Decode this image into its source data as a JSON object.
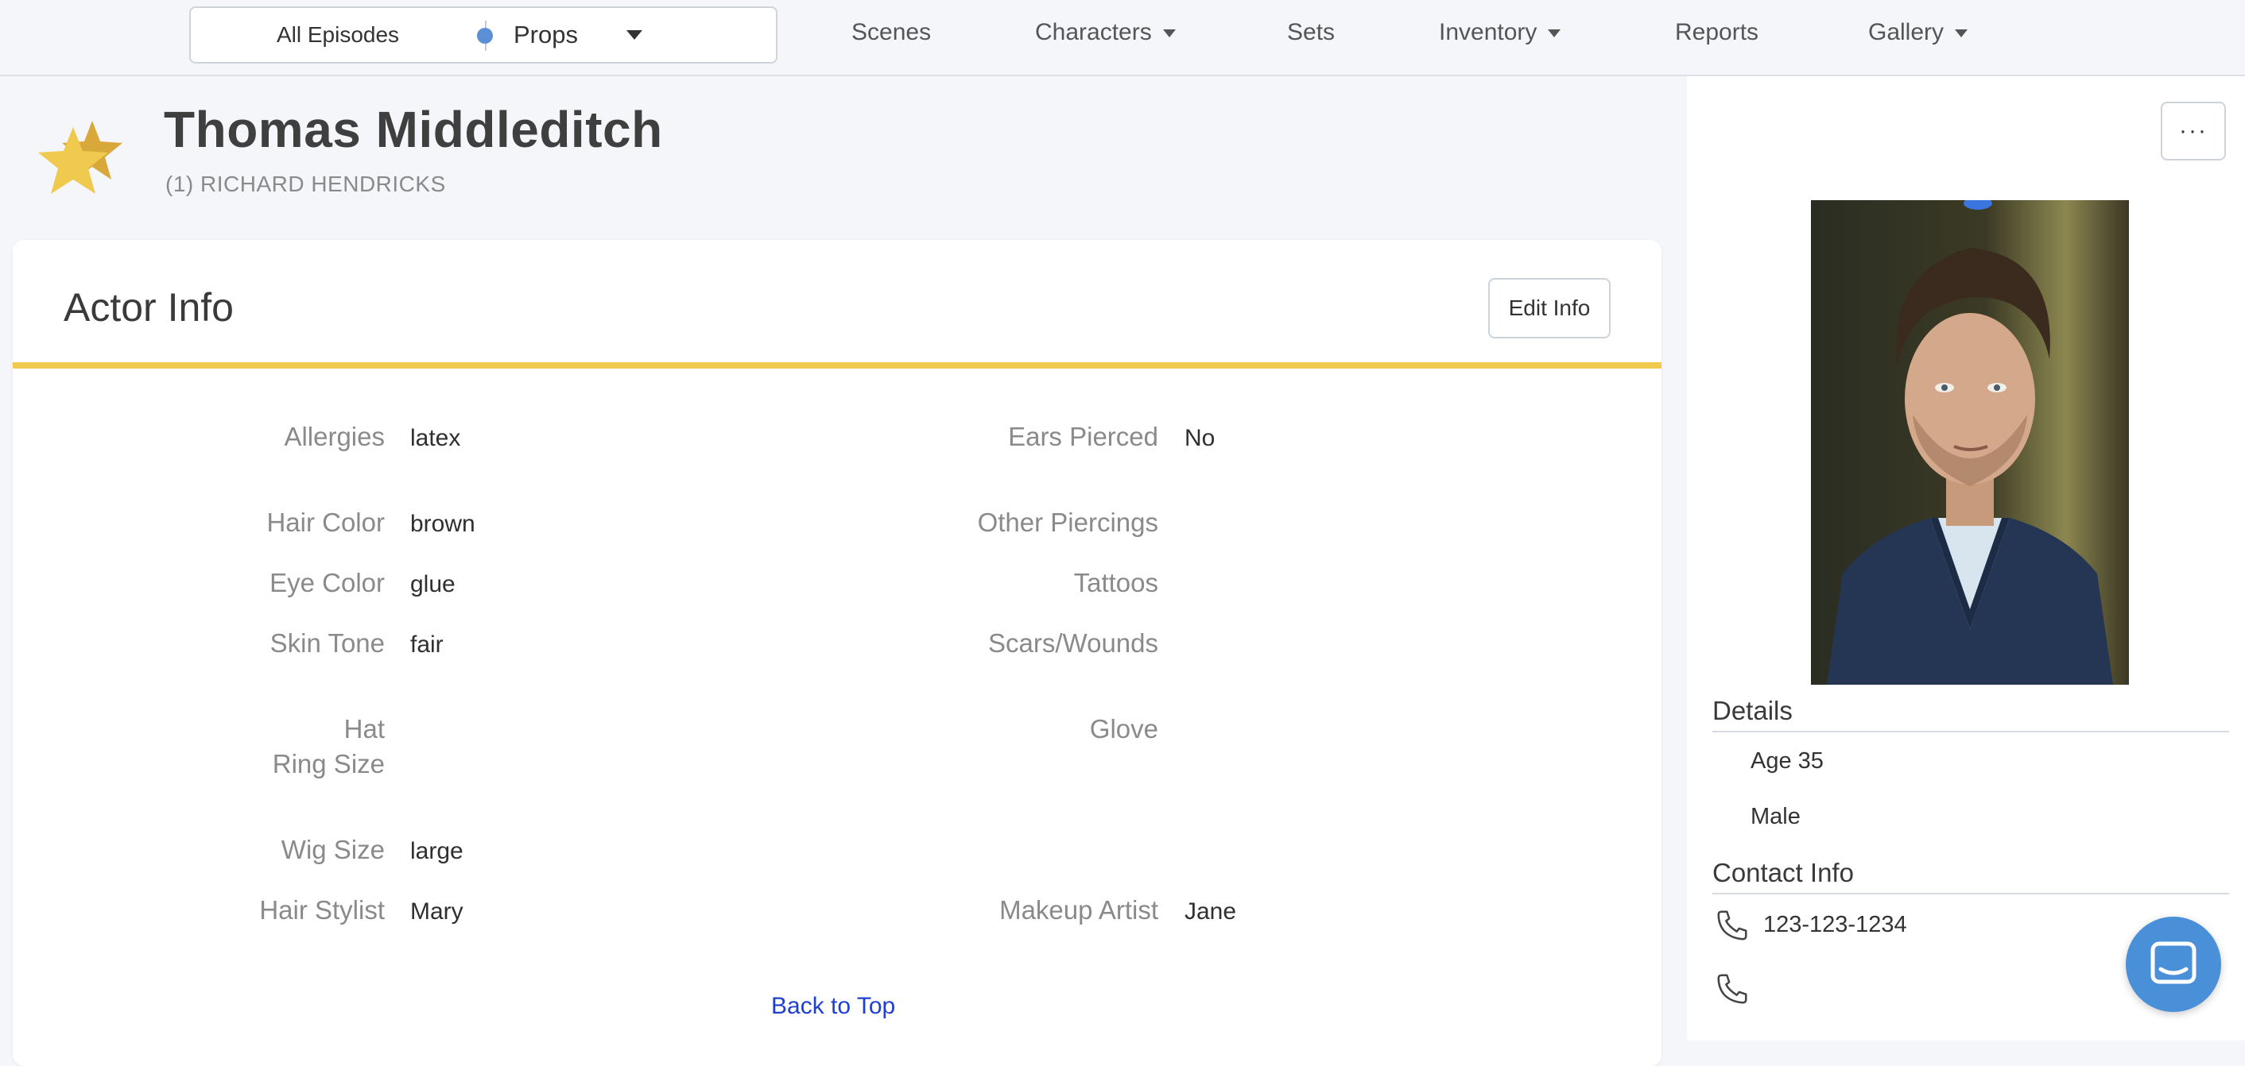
{
  "topnav": {
    "episode_selector": "All Episodes",
    "department": {
      "label": "Props",
      "color": "#5b8fd6"
    },
    "links": [
      {
        "label": "Scenes",
        "dropdown": false
      },
      {
        "label": "Characters",
        "dropdown": true
      },
      {
        "label": "Sets",
        "dropdown": false
      },
      {
        "label": "Inventory",
        "dropdown": true
      },
      {
        "label": "Reports",
        "dropdown": false
      },
      {
        "label": "Gallery",
        "dropdown": true
      }
    ]
  },
  "header": {
    "actor_name": "Thomas Middleditch",
    "role": "(1) RICHARD HENDRICKS",
    "star_icon": "star-icon"
  },
  "actor_info": {
    "title": "Actor Info",
    "edit_label": "Edit Info",
    "left_fields": [
      {
        "label": "Allergies",
        "value": "latex"
      },
      {
        "label": "Hair Color",
        "value": "brown"
      },
      {
        "label": "Eye Color",
        "value": "glue"
      },
      {
        "label": "Skin Tone",
        "value": "fair"
      },
      {
        "label": "Hat",
        "label2": "Ring Size",
        "value": ""
      },
      {
        "label": "Wig Size",
        "value": "large"
      },
      {
        "label": "Hair Stylist",
        "value": "Mary"
      }
    ],
    "right_fields": [
      {
        "label": "Ears Pierced",
        "value": "No"
      },
      {
        "label": "Other Piercings",
        "value": ""
      },
      {
        "label": "Tattoos",
        "value": ""
      },
      {
        "label": "Scars/Wounds",
        "value": ""
      },
      {
        "label": "Glove",
        "value": ""
      },
      {
        "label": "Makeup Artist",
        "value": "Jane"
      }
    ],
    "back_to_top": "Back to Top"
  },
  "sidebar": {
    "more_label": "···",
    "details_title": "Details",
    "details": [
      "Age 35",
      "Male"
    ],
    "contact_title": "Contact Info",
    "phones": [
      "123-123-1234",
      ""
    ]
  },
  "colors": {
    "accent_rule": "#f0c94f",
    "star": "#f0c94f",
    "link": "#1e3fd0",
    "chat": "#4a90d9"
  }
}
